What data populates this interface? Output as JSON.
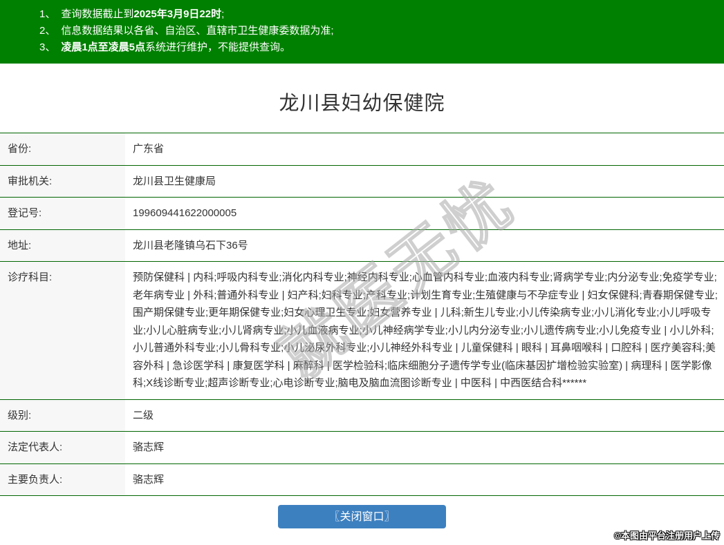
{
  "colors": {
    "notice_bg": "#008000",
    "table_border": "#006400",
    "button_bg": "#3d80c0"
  },
  "notice_bar": {
    "items": [
      {
        "num": "1、",
        "pre": "查询数据截止到",
        "bold": "2025年3月9日22时",
        "post": ";"
      },
      {
        "num": "2、",
        "pre": "信息数据结果以各省、自治区、直辖市卫生健康委数据为准;",
        "bold": "",
        "post": ""
      },
      {
        "num": "3、",
        "pre": "",
        "bold": "凌晨1点至凌晨5点",
        "post": "系统进行维护，不能提供查询。"
      }
    ]
  },
  "page": {
    "title": "龙川县妇幼保健院"
  },
  "info_table": {
    "rows": [
      {
        "label": "省份:",
        "value": "广东省"
      },
      {
        "label": "审批机关:",
        "value": "龙川县卫生健康局"
      },
      {
        "label": "登记号:",
        "value": "199609441622000005"
      },
      {
        "label": "地址:",
        "value": "龙川县老隆镇乌石下36号"
      },
      {
        "label": "诊疗科目:",
        "value": "预防保健科 | 内科;呼吸内科专业;消化内科专业;神经内科专业;心血管内科专业;血液内科专业;肾病学专业;内分泌专业;免疫学专业;老年病专业 | 外科;普通外科专业 | 妇产科;妇科专业;产科专业;计划生育专业;生殖健康与不孕症专业 | 妇女保健科;青春期保健专业;围产期保健专业;更年期保健专业;妇女心理卫生专业;妇女营养专业 | 儿科;新生儿专业;小儿传染病专业;小儿消化专业;小儿呼吸专业;小儿心脏病专业;小儿肾病专业;小儿血液病专业;小儿神经病学专业;小儿内分泌专业;小儿遗传病专业;小儿免疫专业 | 小儿外科;小儿普通外科专业;小儿骨科专业;小儿泌尿外科专业;小儿神经外科专业 | 儿童保健科 | 眼科 | 耳鼻咽喉科 | 口腔科 | 医疗美容科;美容外科 | 急诊医学科 | 康复医学科 | 麻醉科 | 医学检验科;临床细胞分子遗传学专业(临床基因扩增检验实验室) | 病理科 | 医学影像科;X线诊断专业;超声诊断专业;心电诊断专业;脑电及脑血流图诊断专业 | 中医科 | 中西医结合科******"
      },
      {
        "label": "级别:",
        "value": "二级"
      },
      {
        "label": "法定代表人:",
        "value": "骆志辉"
      },
      {
        "label": "主要负责人:",
        "value": "骆志辉"
      }
    ]
  },
  "actions": {
    "close_button_label": "〖关闭窗口〗"
  },
  "watermark": {
    "diagonal_text": "就医无忧",
    "photo_credit": "©本图由平台注册用户上传"
  }
}
